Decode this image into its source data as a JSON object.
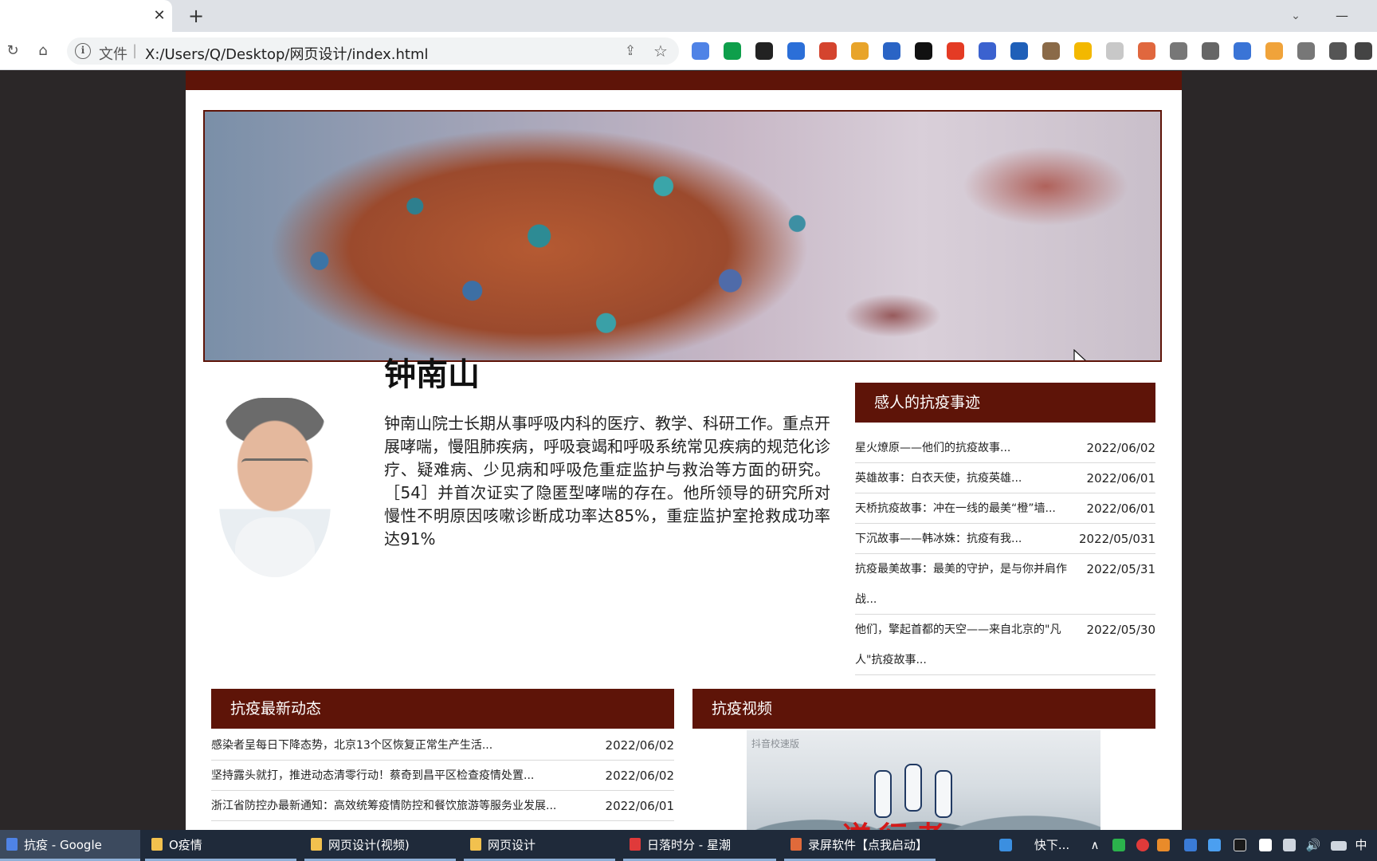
{
  "browser": {
    "tab_close": "✕",
    "new_tab": "+",
    "tab_search": "⌄",
    "minimize": "—",
    "omnibox_info": "i",
    "omnibox_label": "文件",
    "omnibox_sep": "|",
    "url": "X:/Users/Q/Desktop/网页设计/index.html",
    "share_icon": "⇪",
    "star_icon": "☆",
    "extensions": [
      {
        "name": "chrome-ext-icon",
        "color": "#4f83e6"
      },
      {
        "name": "shield-ext-icon",
        "color": "#0e9f4b"
      },
      {
        "name": "box-ext-icon",
        "color": "#222222"
      },
      {
        "name": "search-ext-icon",
        "color": "#2b6fd8"
      },
      {
        "name": "translate-ext-icon",
        "color": "#d4442e"
      },
      {
        "name": "circle-ext-icon",
        "color": "#e8a42a"
      },
      {
        "name": "download-ext-icon",
        "color": "#2a64c5"
      },
      {
        "name": "dark-ext-icon",
        "color": "#111111"
      },
      {
        "name": "stop-ext-icon",
        "color": "#e43b24"
      },
      {
        "name": "g-ext-icon",
        "color": "#3b62cf"
      },
      {
        "name": "y-ext-icon",
        "color": "#1f5fb8"
      },
      {
        "name": "owl-ext-icon",
        "color": "#8a6a48"
      },
      {
        "name": "yellow-ext-icon",
        "color": "#f3b800"
      },
      {
        "name": "grid-ext-icon",
        "color": "#c8c8c8"
      },
      {
        "name": "network-ext-icon",
        "color": "#e0673e"
      },
      {
        "name": "cloud-ext-icon",
        "color": "#777777"
      },
      {
        "name": "camera-ext-icon",
        "color": "#666666"
      },
      {
        "name": "jh-ext-icon",
        "color": "#3a74d6"
      },
      {
        "name": "orange-ext-icon",
        "color": "#f0a33a"
      },
      {
        "name": "gear-ext-icon",
        "color": "#777777"
      },
      {
        "name": "puzzle-ext-icon",
        "color": "#555555"
      },
      {
        "name": "sidepanel-ext-icon",
        "color": "#444444"
      }
    ]
  },
  "person": {
    "name": "钟南山",
    "bio": "钟南山院士长期从事呼吸内科的医疗、教学、科研工作。重点开展哮喘，慢阻肺疾病，呼吸衰竭和呼吸系统常见疾病的规范化诊疗、疑难病、少见病和呼吸危重症监护与救治等方面的研究。［54］并首次证实了隐匿型哮喘的存在。他所领导的研究所对慢性不明原因咳嗽诊断成功率达85%，重症监护室抢救成功率达91%"
  },
  "stories": {
    "title": "感人的抗疫事迹",
    "items": [
      {
        "title": "星火燎原——他们的抗疫故事...",
        "date": "2022/06/02"
      },
      {
        "title": "英雄故事：白衣天使，抗疫英雄...",
        "date": "2022/06/01"
      },
      {
        "title": "天桥抗疫故事：冲在一线的最美“橙”墙...",
        "date": "2022/06/01"
      },
      {
        "title": "下沉故事——韩冰姝：抗疫有我...",
        "date": "2022/05/031"
      },
      {
        "title": "抗疫最美故事：最美的守护，是与你并肩作战...",
        "date": "2022/05/31"
      },
      {
        "title": "他们，擎起首都的天空——来自北京的\"凡人\"抗疫故事...",
        "date": "2022/05/30"
      }
    ]
  },
  "news": {
    "title": "抗疫最新动态",
    "items": [
      {
        "title": "感染者呈每日下降态势，北京13个区恢复正常生产生活...",
        "date": "2022/06/02"
      },
      {
        "title": "坚持露头就打，推进动态清零行动！蔡奇到昌平区检查疫情处置...",
        "date": "2022/06/02"
      },
      {
        "title": "浙江省防控办最新通知：高效统筹疫情防控和餐饮旅游等服务业发展...",
        "date": "2022/06/01"
      }
    ]
  },
  "video": {
    "title": "抗疫视频",
    "watermark": "抖音校速版",
    "caption": "逆行者"
  },
  "taskbar": {
    "tasks": [
      {
        "label": "抗疫 - Google Chro...",
        "icon_color": "#4f83e6"
      },
      {
        "label": "O疫情",
        "icon_color": "#f2c14e"
      },
      {
        "label": "网页设计(视频)",
        "icon_color": "#f2c14e"
      },
      {
        "label": "网页设计",
        "icon_color": "#f2c14e"
      },
      {
        "label": "日落时分 - 星潮",
        "icon_color": "#e03a3a"
      },
      {
        "label": "录屏软件【点我启动】",
        "icon_color": "#e06a3a"
      }
    ],
    "weather": "快下...",
    "tray_up": "∧",
    "volume": "🔊",
    "ime": "中"
  },
  "colors": {
    "accent": "#5e1408",
    "page_bg": "#2b2728",
    "taskbar": "#1f2a3a"
  }
}
